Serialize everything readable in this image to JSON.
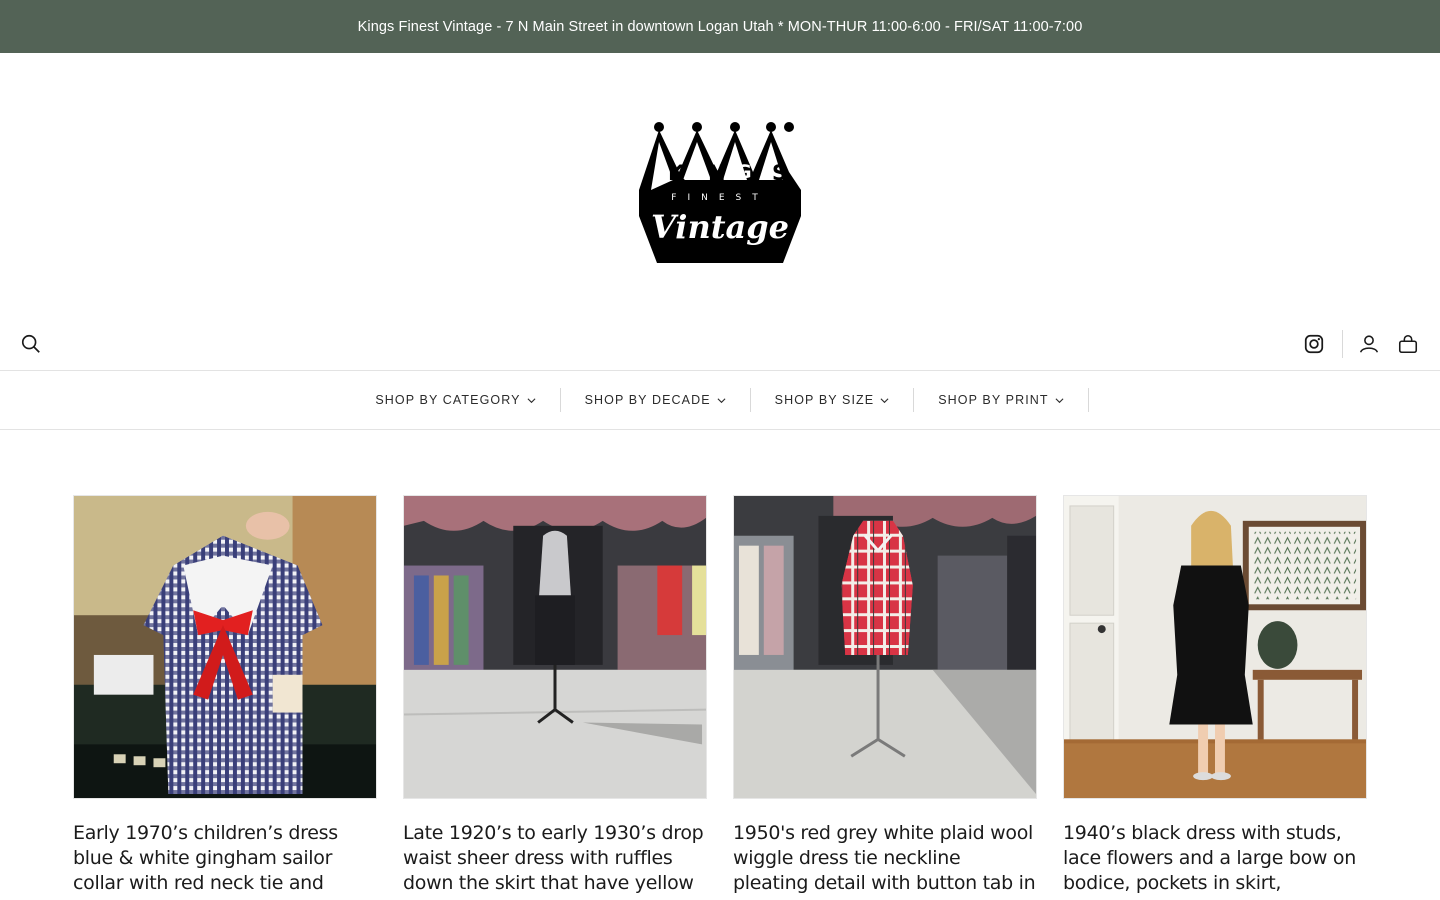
{
  "announcement": {
    "text": "Kings Finest Vintage - 7 N Main Street in downtown Logan Utah * MON-THUR 11:00-6:00 - FRI/SAT 11:00-7:00",
    "background": "#536356"
  },
  "logo": {
    "brand": "Kings Finest Vintage",
    "line1": "KINGS",
    "line2": "FINEST",
    "line3": "Vintage"
  },
  "utility": {
    "icons": [
      "search-icon",
      "instagram-icon",
      "account-icon",
      "cart-icon"
    ]
  },
  "nav": {
    "items": [
      {
        "label": "SHOP BY CATEGORY"
      },
      {
        "label": "SHOP BY DECADE"
      },
      {
        "label": "SHOP BY SIZE"
      },
      {
        "label": "SHOP BY PRINT"
      }
    ]
  },
  "products": [
    {
      "title": "Early 1970’s children’s dress blue & white gingham sailor collar with red neck tie and matching"
    },
    {
      "title": "Late 1920’s to early 1930’s drop waist sheer dress with ruffles down the skirt that have yellow"
    },
    {
      "title": "1950's red grey white plaid wool wiggle dress tie neckline pleating detail with button tab in back"
    },
    {
      "title": "1940’s black dress with studs, lace flowers and a large bow on bodice, pockets in skirt, excellent"
    }
  ]
}
